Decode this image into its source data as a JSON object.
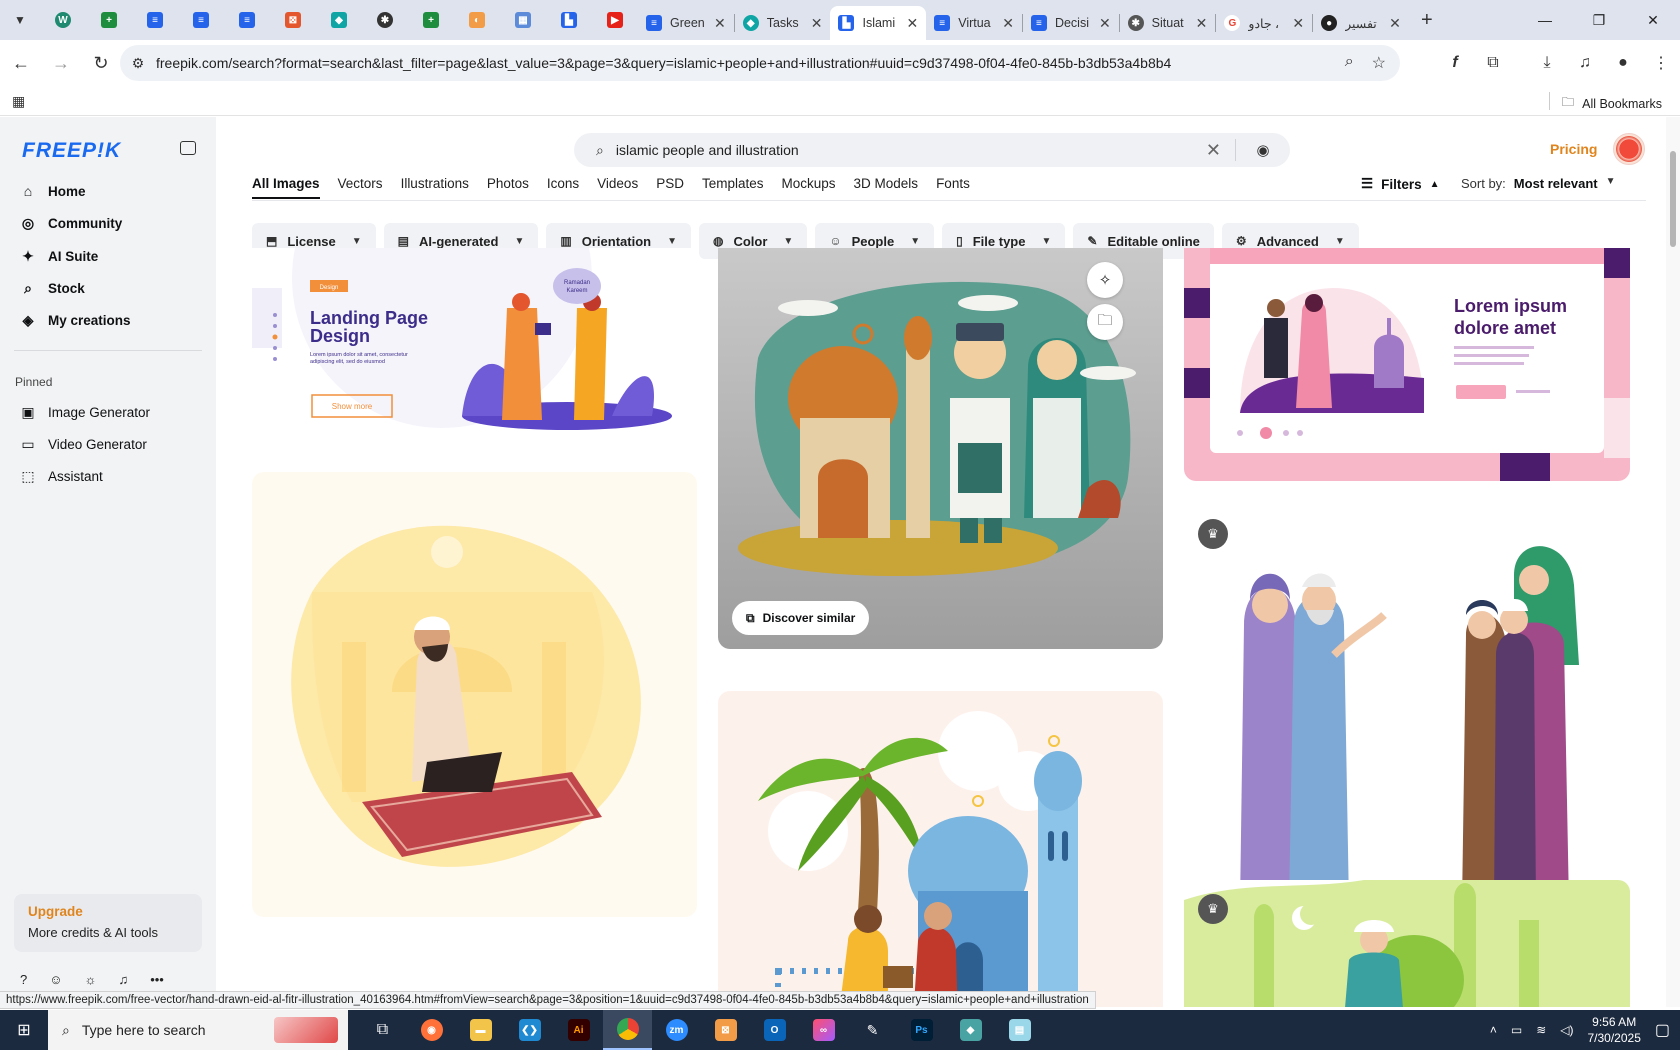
{
  "browser": {
    "tabs": [
      {
        "label": "Green",
        "favicon": "docs",
        "color": "#2563eb"
      },
      {
        "label": "Tasks",
        "favicon": "tasks",
        "color": "#0ea5a4"
      },
      {
        "label": "Islami",
        "favicon": "freepik",
        "color": "#2563eb",
        "active": true
      },
      {
        "label": "Virtua",
        "favicon": "docs",
        "color": "#2563eb"
      },
      {
        "label": "Decisi",
        "favicon": "docs",
        "color": "#2563eb"
      },
      {
        "label": "Situat",
        "favicon": "chatgpt",
        "color": "#444"
      },
      {
        "label": "جادو ،",
        "favicon": "google",
        "color": "#ea4335"
      },
      {
        "label": "تفسير",
        "favicon": "site",
        "color": "#222"
      }
    ],
    "url": "freepik.com/search?format=search&last_filter=page&last_value=3&page=3&query=islamic+people+and+illustration#uuid=c9d37498-0f04-4fe0-845b-b3db53a4b8b4",
    "bookmarks_label": "All Bookmarks",
    "status_url": "https://www.freepik.com/free-vector/hand-drawn-eid-al-fitr-illustration_40163964.htm#fromView=search&page=3&position=1&uuid=c9d37498-0f04-4fe0-845b-b3db53a4b8b4&query=islamic+people+and+illustration"
  },
  "sidebar": {
    "logo": "FREEP!K",
    "main_items": [
      {
        "label": "Home",
        "icon": "home-icon"
      },
      {
        "label": "Community",
        "icon": "globe-icon"
      },
      {
        "label": "AI Suite",
        "icon": "sparkle-icon"
      },
      {
        "label": "Stock",
        "icon": "search-icon"
      },
      {
        "label": "My creations",
        "icon": "stack-icon"
      }
    ],
    "pinned_label": "Pinned",
    "pinned_items": [
      {
        "label": "Image Generator",
        "icon": "image-icon"
      },
      {
        "label": "Video Generator",
        "icon": "video-icon"
      },
      {
        "label": "Assistant",
        "icon": "assistant-icon"
      }
    ],
    "upgrade_title": "Upgrade",
    "upgrade_sub": "More credits & AI tools"
  },
  "search": {
    "query": "islamic people and illustration"
  },
  "header": {
    "pricing": "Pricing"
  },
  "categories": [
    "All Images",
    "Vectors",
    "Illustrations",
    "Photos",
    "Icons",
    "Videos",
    "PSD",
    "Templates",
    "Mockups",
    "3D Models",
    "Fonts"
  ],
  "filters_label": "Filters",
  "sort": {
    "label": "Sort by:",
    "value": "Most relevant"
  },
  "chips": [
    {
      "label": "License",
      "icon": "license-icon"
    },
    {
      "label": "AI-generated",
      "icon": "ai-icon"
    },
    {
      "label": "Orientation",
      "icon": "orientation-icon"
    },
    {
      "label": "Color",
      "icon": "palette-icon"
    },
    {
      "label": "People",
      "icon": "people-icon"
    },
    {
      "label": "File type",
      "icon": "file-icon"
    },
    {
      "label": "Editable online",
      "icon": "pen-icon"
    },
    {
      "label": "Advanced",
      "icon": "gear-icon"
    }
  ],
  "cards": {
    "landing": {
      "tag": "Design",
      "title_1": "Landing Page",
      "title_2": "Design",
      "body_1": "Lorem ipsum dolor sit amet, consectetur",
      "body_2": "adipiscing elit, sed do eiusmod",
      "button": "Show more",
      "bubble_1": "Ramadan",
      "bubble_2": "Kareem"
    },
    "mosque_people": {
      "discover": "Discover similar"
    },
    "lorem": {
      "title_1": "Lorem ipsum",
      "title_2": "dolore amet"
    }
  },
  "taskbar": {
    "search_placeholder": "Type here to search",
    "time": "9:56 AM",
    "date": "7/30/2025"
  }
}
